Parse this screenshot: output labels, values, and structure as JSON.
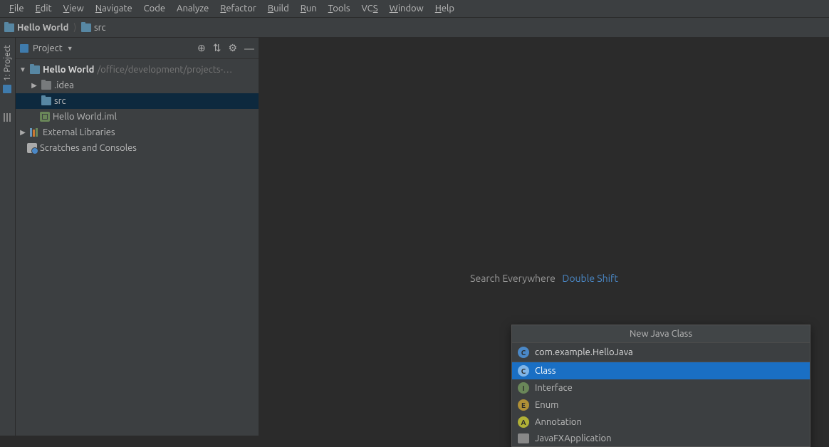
{
  "menu": [
    "File",
    "Edit",
    "View",
    "Navigate",
    "Code",
    "Analyze",
    "Refactor",
    "Build",
    "Run",
    "Tools",
    "VCS",
    "Window",
    "Help"
  ],
  "menu_underline": [
    0,
    0,
    0,
    0,
    null,
    null,
    0,
    0,
    0,
    0,
    2,
    0,
    0
  ],
  "breadcrumb": {
    "project": "Hello World",
    "folder": "src"
  },
  "sidebar": {
    "title": "Project",
    "vertical_label": "1: Project",
    "actions": {
      "collapse_icon": "⊕",
      "filter_icon": "⇅",
      "gear_icon": "⚙",
      "hide_icon": "—"
    }
  },
  "tree": {
    "root_name": "Hello World",
    "root_path": "/office/development/projects-…",
    "idea": ".idea",
    "src": "src",
    "iml": "Hello World.iml",
    "external": "External Libraries",
    "scratches": "Scratches and Consoles"
  },
  "hint": {
    "label": "Search Everywhere",
    "key": "Double Shift"
  },
  "popup": {
    "title": "New Java Class",
    "input": "com.example.HelloJava",
    "items": [
      {
        "badge": "c",
        "label": "Class",
        "sel": true
      },
      {
        "badge": "i",
        "label": "Interface",
        "sel": false
      },
      {
        "badge": "e",
        "label": "Enum",
        "sel": false
      },
      {
        "badge": "a",
        "label": "Annotation",
        "sel": false
      },
      {
        "badge": "app",
        "label": "JavaFXApplication",
        "sel": false
      }
    ]
  }
}
